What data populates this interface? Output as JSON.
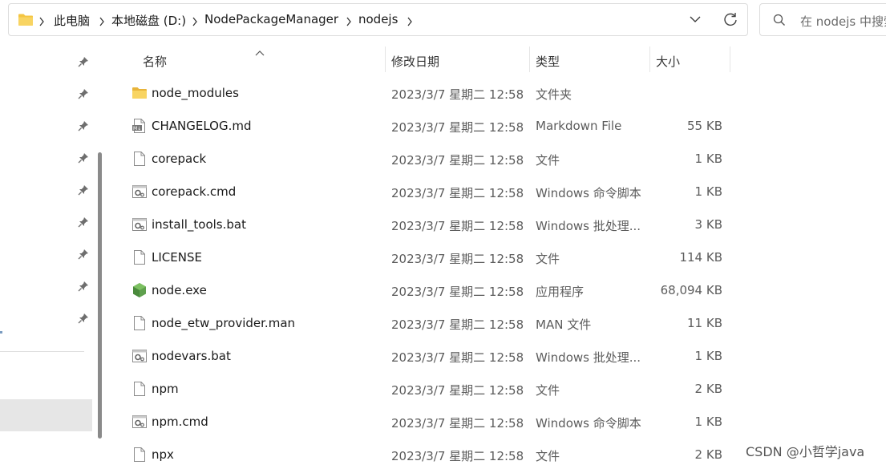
{
  "address_bar": {
    "crumbs": [
      "此电脑",
      "本地磁盘 (D:)",
      "NodePackageManager",
      "nodejs"
    ]
  },
  "search": {
    "placeholder": "在 nodejs 中搜索"
  },
  "columns": {
    "name": "名称",
    "date": "修改日期",
    "type": "类型",
    "size": "大小"
  },
  "files": [
    {
      "name": "node_modules",
      "date": "2023/3/7 星期二 12:58",
      "type": "文件夹",
      "size": "",
      "icon": "folder-icon"
    },
    {
      "name": "CHANGELOG.md",
      "date": "2023/3/7 星期二 12:58",
      "type": "Markdown File",
      "size": "55 KB",
      "icon": "markdown-file-icon"
    },
    {
      "name": "corepack",
      "date": "2023/3/7 星期二 12:58",
      "type": "文件",
      "size": "1 KB",
      "icon": "file-icon"
    },
    {
      "name": "corepack.cmd",
      "date": "2023/3/7 星期二 12:58",
      "type": "Windows 命令脚本",
      "size": "1 KB",
      "icon": "script-icon"
    },
    {
      "name": "install_tools.bat",
      "date": "2023/3/7 星期二 12:58",
      "type": "Windows 批处理...",
      "size": "3 KB",
      "icon": "script-icon"
    },
    {
      "name": "LICENSE",
      "date": "2023/3/7 星期二 12:58",
      "type": "文件",
      "size": "114 KB",
      "icon": "file-icon"
    },
    {
      "name": "node.exe",
      "date": "2023/3/7 星期二 12:58",
      "type": "应用程序",
      "size": "68,094 KB",
      "icon": "node-exe-icon"
    },
    {
      "name": "node_etw_provider.man",
      "date": "2023/3/7 星期二 12:58",
      "type": "MAN 文件",
      "size": "11 KB",
      "icon": "file-icon"
    },
    {
      "name": "nodevars.bat",
      "date": "2023/3/7 星期二 12:58",
      "type": "Windows 批处理...",
      "size": "1 KB",
      "icon": "script-icon"
    },
    {
      "name": "npm",
      "date": "2023/3/7 星期二 12:58",
      "type": "文件",
      "size": "2 KB",
      "icon": "file-icon"
    },
    {
      "name": "npm.cmd",
      "date": "2023/3/7 星期二 12:58",
      "type": "Windows 命令脚本",
      "size": "1 KB",
      "icon": "script-icon"
    },
    {
      "name": "npx",
      "date": "2023/3/7 星期二 12:58",
      "type": "文件",
      "size": "2 KB",
      "icon": "file-icon"
    }
  ],
  "watermark": "CSDN @小哲学java",
  "colors": {
    "folder": "#f4c542",
    "node_green": "#5fa04e",
    "nav_selected": "#e6e6e6"
  }
}
